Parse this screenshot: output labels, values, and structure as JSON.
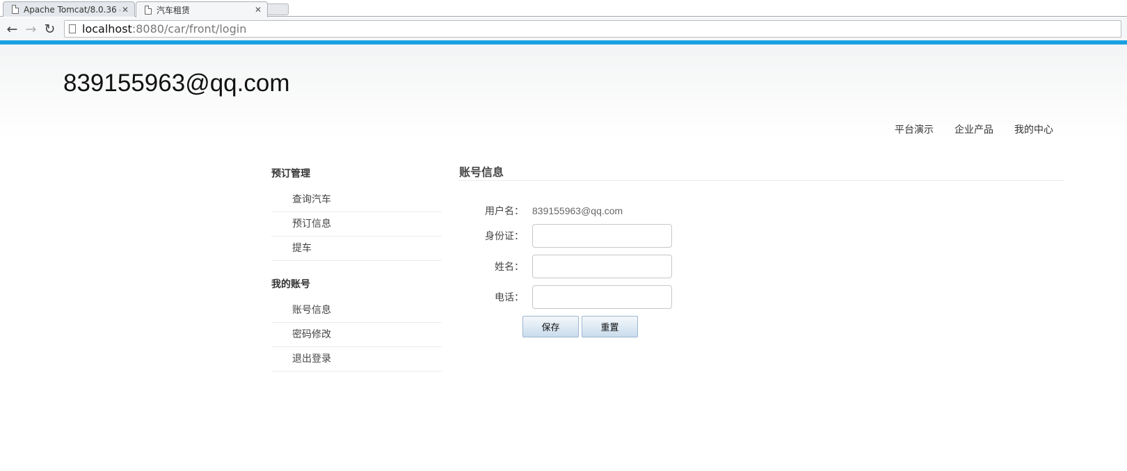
{
  "browser": {
    "tabs": [
      {
        "title": "Apache Tomcat/8.0.36 -",
        "close": "✕"
      },
      {
        "title": "汽车租赁",
        "close": "✕"
      }
    ],
    "nav": {
      "back": "←",
      "forward": "→",
      "reload": "↻"
    },
    "url": {
      "host": "localhost",
      "path": ":8080/car/front/login"
    },
    "accent_color": "#1ba1e2"
  },
  "header": {
    "site_title": "839155963@qq.com",
    "nav": [
      "平台演示",
      "企业产品",
      "我的中心"
    ]
  },
  "sidebar": {
    "groups": [
      {
        "title": "预订管理",
        "items": [
          "查询汽车",
          "预订信息",
          "提车"
        ]
      },
      {
        "title": "我的账号",
        "items": [
          "账号信息",
          "密码修改",
          "退出登录"
        ]
      }
    ]
  },
  "main": {
    "section_title": "账号信息",
    "form": {
      "username_label": "用户名：",
      "username_value": "839155963@qq.com",
      "idcard_label": "身份证：",
      "idcard_value": "",
      "name_label": "姓名：",
      "name_value": "",
      "phone_label": "电话：",
      "phone_value": "",
      "save_label": "保存",
      "reset_label": "重置"
    }
  }
}
